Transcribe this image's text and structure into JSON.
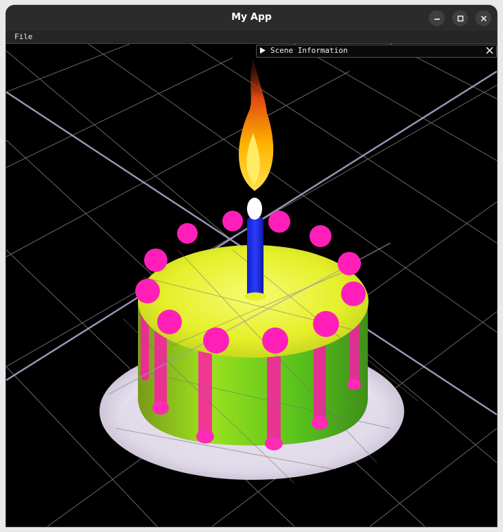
{
  "window": {
    "title": "My App"
  },
  "menubar": {
    "items": [
      {
        "label": "File"
      }
    ]
  },
  "scene_panel": {
    "title": "Scene Information"
  },
  "icons": {
    "minimize": "minimize-icon",
    "maximize": "maximize-icon",
    "close": "close-icon",
    "expand": "triangle-right-icon",
    "panel_close": "close-icon"
  },
  "colors": {
    "titlebar": "#2b2b2b",
    "background": "#000000",
    "grid": "#8a8a8a",
    "cake_top": "#e8f23a",
    "cake_side": "#7fd21a",
    "decorations": "#ff1fb8",
    "candle": "#1a2cf5",
    "flame": "#ffb000",
    "plate": "#f2eef7"
  }
}
